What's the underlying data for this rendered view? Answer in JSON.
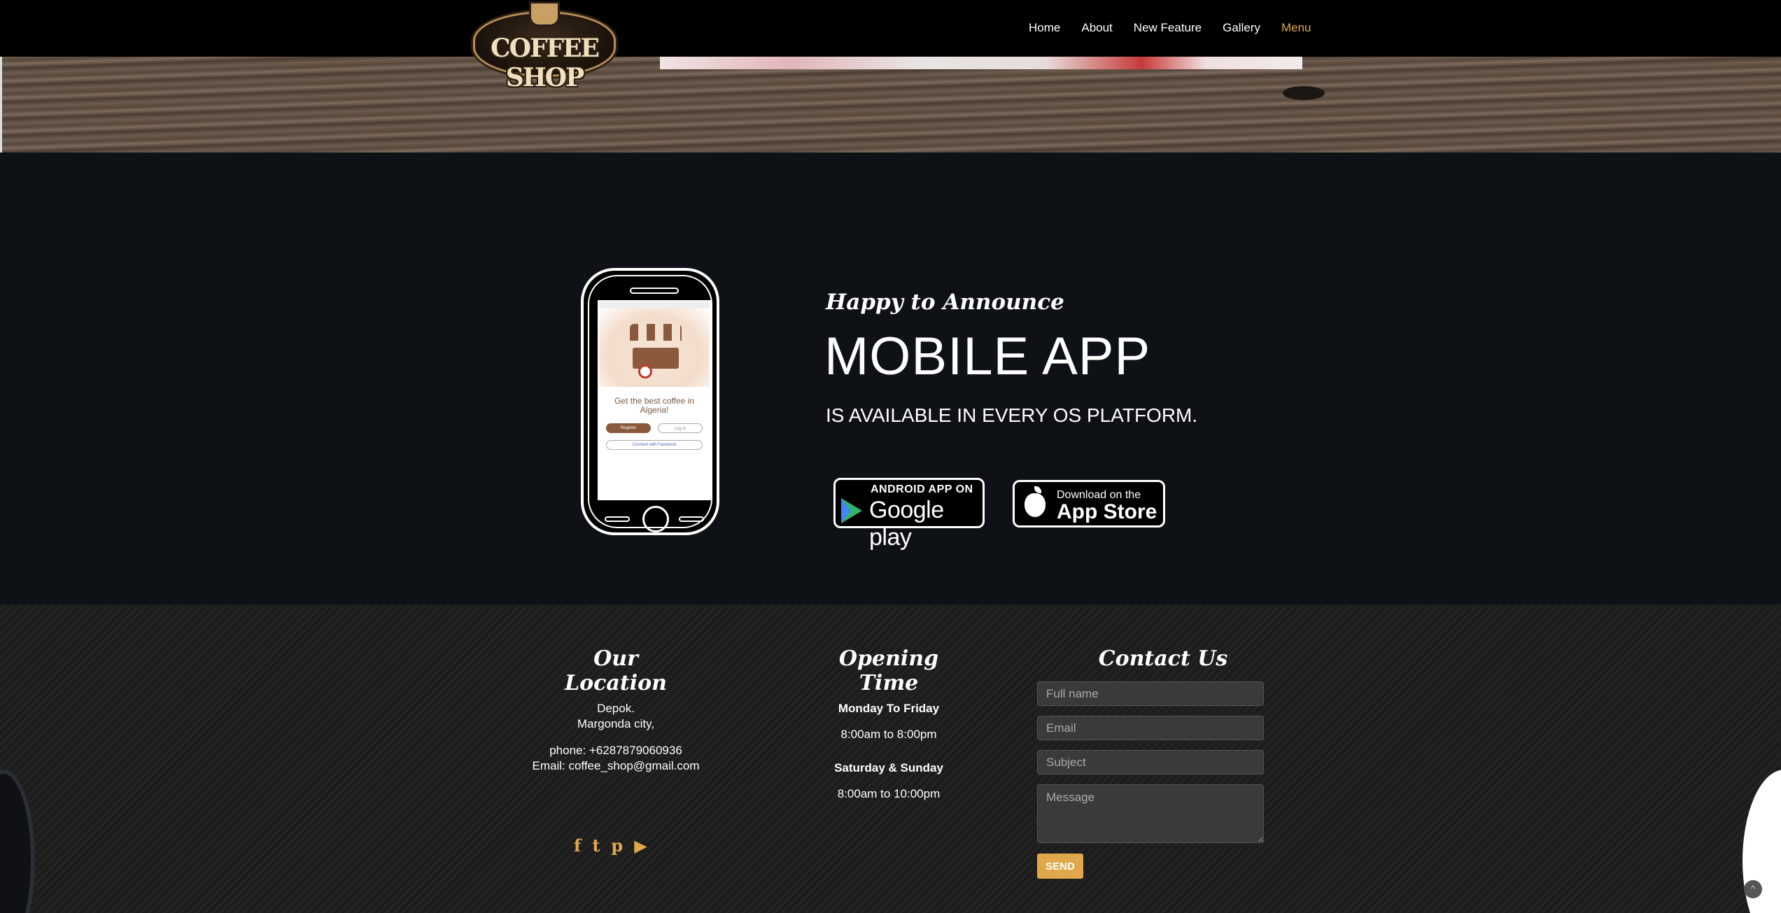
{
  "brand": {
    "logo_text": "COFFEE SHOP"
  },
  "nav": {
    "items": [
      {
        "label": "Home"
      },
      {
        "label": "About"
      },
      {
        "label": "New Feature"
      },
      {
        "label": "Gallery"
      },
      {
        "label": "Menu"
      }
    ],
    "active_color": "#e0a84a"
  },
  "phone_screen": {
    "tagline": "Get the best coffee in Algeria!",
    "register_label": "Register",
    "login_label": "Log in",
    "facebook_label": "Connect with Facebook"
  },
  "app_section": {
    "kicker": "Happy to Announce",
    "title": "MOBILE APP",
    "subtitle": "IS AVAILABLE IN EVERY OS PLATFORM.",
    "google_play": {
      "top": "ANDROID APP ON",
      "bottom": "Google play"
    },
    "app_store": {
      "top": "Download on the",
      "bottom": "App Store"
    }
  },
  "footer": {
    "location": {
      "heading": "Our Location",
      "line1": "Depok.",
      "line2": "Margonda city,",
      "phone": "phone: +6287879060936",
      "email": "Email: coffee_shop@gmail.com",
      "social_icons": [
        "facebook-icon",
        "twitter-icon",
        "pinterest-icon",
        "youtube-icon"
      ]
    },
    "opening": {
      "heading": "Opening Time",
      "weekday_label": "Monday To Friday",
      "weekday_hours": "8:00am to 8:00pm",
      "weekend_label": "Saturday & Sunday",
      "weekend_hours": "8:00am to 10:00pm"
    },
    "contact": {
      "heading": "Contact Us",
      "name_placeholder": "Full name",
      "email_placeholder": "Email",
      "subject_placeholder": "Subject",
      "message_placeholder": "Message",
      "send_label": "SEND",
      "accent_color": "#e0a84a"
    }
  }
}
